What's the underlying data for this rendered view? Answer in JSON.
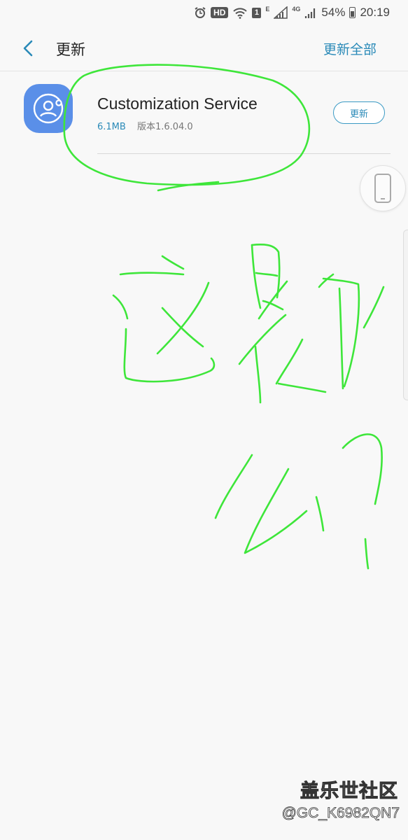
{
  "status_bar": {
    "hd": "HD",
    "sim": "1",
    "net_e": "E",
    "net_4g": "4G",
    "battery": "54%",
    "time": "20:19"
  },
  "header": {
    "title": "更新",
    "update_all": "更新全部"
  },
  "updates": [
    {
      "name": "Customization Service",
      "size": "6.1MB",
      "version": "版本1.6.04.0",
      "button": "更新"
    }
  ],
  "icons": {
    "alarm": "alarm-icon",
    "wifi": "wifi-icon",
    "signal": "signal-icon",
    "back": "back-arrow-icon",
    "app": "customization-service-icon",
    "phone": "phone-icon"
  },
  "colors": {
    "accent": "#2a8ab8",
    "app_icon_bg": "#5a8fe8",
    "ink": "#3ee63a"
  },
  "watermark": {
    "logo": "盖乐世社区",
    "user": "@GC_K6982QN7"
  }
}
